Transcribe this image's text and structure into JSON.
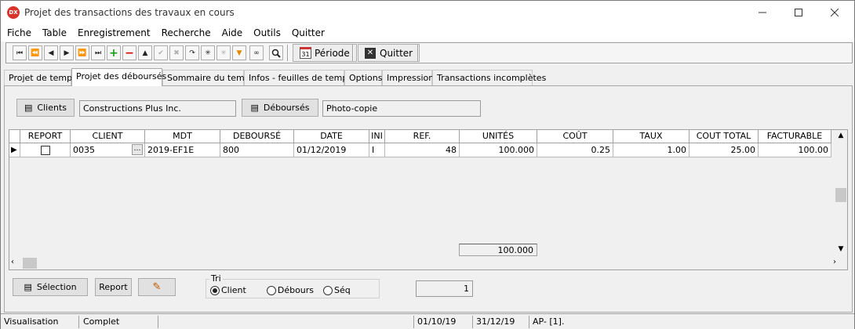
{
  "window": {
    "title": "Projet des transactions des travaux en cours",
    "app_icon": "DX"
  },
  "menu": [
    "Fiche",
    "Table",
    "Enregistrement",
    "Recherche",
    "Aide",
    "Outils",
    "Quitter"
  ],
  "toolbar": {
    "periode_label": "Période",
    "periode_icon_text": "31",
    "quitter_label": "Quitter"
  },
  "tabs": [
    "Projet de temps",
    "Projet des déboursés",
    "Sommaire du temps",
    "Infos - feuilles de temps",
    "Options",
    "Impression",
    "Transactions incomplètes"
  ],
  "active_tab": 1,
  "filters": {
    "clients_label": "Clients",
    "clients_value": "Constructions Plus  Inc.",
    "debourses_label": "Déboursés",
    "debourses_value": "Photo-copie"
  },
  "grid": {
    "columns": [
      "REPORT",
      "CLIENT",
      "MDT",
      "DEBOURSÉ",
      "DATE",
      "INI",
      "REF.",
      "UNITÉS",
      "COÛT",
      "TAUX",
      "COUT TOTAL",
      "FACTURABLE"
    ],
    "rows": [
      {
        "report": false,
        "client": "0035",
        "mdt": "2019-EF1E",
        "debourse": "800",
        "date": "01/12/2019",
        "ini": "I",
        "ref": "48",
        "unites": "100.000",
        "cout": "0.25",
        "taux": "1.00",
        "cout_total": "25.00",
        "facturable": "100.00"
      }
    ],
    "total_unites": "100.000"
  },
  "bottom": {
    "selection_label": "Sélection",
    "report_label": "Report",
    "tri_label": "Tri",
    "tri_options": [
      "Client",
      "Débours",
      "Séq"
    ],
    "tri_selected": "Client",
    "count": "1"
  },
  "status": {
    "mode": "Visualisation",
    "state": "Complet",
    "date_from": "01/10/19",
    "date_to": "31/12/19",
    "code": "AP- [1]."
  }
}
